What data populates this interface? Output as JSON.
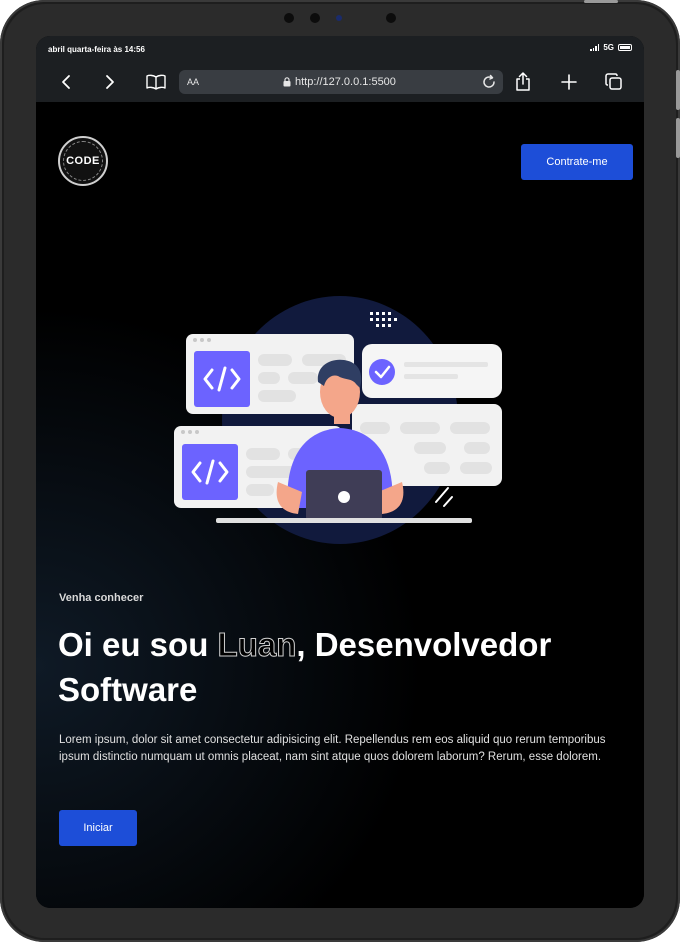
{
  "status_bar": {
    "time": "abril quarta-feira às 14:56",
    "network": "5G"
  },
  "browser": {
    "text_size_label": "AA",
    "url": "http://127.0.0.1:5500"
  },
  "header": {
    "logo_text": "CODE",
    "hire_button": "Contrate-me"
  },
  "hero": {
    "subtitle": "Venha conhecer",
    "headline_before": "Oi eu sou ",
    "headline_name": "Luan",
    "headline_after": ", Desenvolvedor Software",
    "paragraph": "Lorem ipsum, dolor sit amet consectetur adipisicing elit. Repellendus rem eos aliquid quo rerum temporibus ipsum distinctio numquam ut omnis placeat, nam sint atque quos dolorem laborum? Rerum, esse dolorem.",
    "start_button": "Iniciar"
  },
  "colors": {
    "accent": "#1d4ed8",
    "illustration_purple": "#6c63ff",
    "page_background": "#000000"
  }
}
